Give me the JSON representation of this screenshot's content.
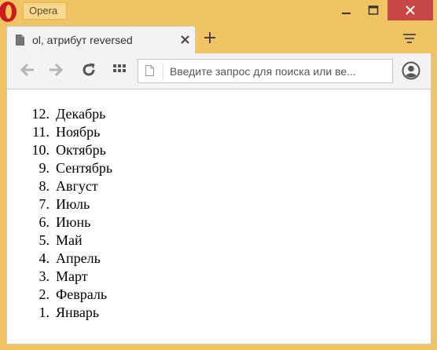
{
  "window": {
    "app_name": "Opera",
    "colors": {
      "frame": "#f0c462",
      "close": "#c74646",
      "logo": "#cc1b1b"
    }
  },
  "tab": {
    "title": "ol, атрибут reversed",
    "icon": "page-icon",
    "close_icon": "close-icon"
  },
  "new_tab_icon": "plus-icon",
  "tab_menu_icon": "tab-menu-icon",
  "toolbar": {
    "back_icon": "back-arrow-icon",
    "forward_icon": "forward-arrow-icon",
    "reload_icon": "reload-icon",
    "speed_dial_icon": "speed-dial-icon",
    "address": {
      "placeholder": "Введите запрос для поиска или ве...",
      "value": ""
    },
    "account_icon": "account-icon"
  },
  "list": {
    "items": [
      {
        "number": "12.",
        "label": "Декабрь"
      },
      {
        "number": "11.",
        "label": "Ноябрь"
      },
      {
        "number": "10.",
        "label": "Октябрь"
      },
      {
        "number": "9.",
        "label": "Сентябрь"
      },
      {
        "number": "8.",
        "label": "Август"
      },
      {
        "number": "7.",
        "label": "Июль"
      },
      {
        "number": "6.",
        "label": "Июнь"
      },
      {
        "number": "5.",
        "label": "Май"
      },
      {
        "number": "4.",
        "label": "Апрель"
      },
      {
        "number": "3.",
        "label": "Март"
      },
      {
        "number": "2.",
        "label": "Февраль"
      },
      {
        "number": "1.",
        "label": "Январь"
      }
    ]
  }
}
